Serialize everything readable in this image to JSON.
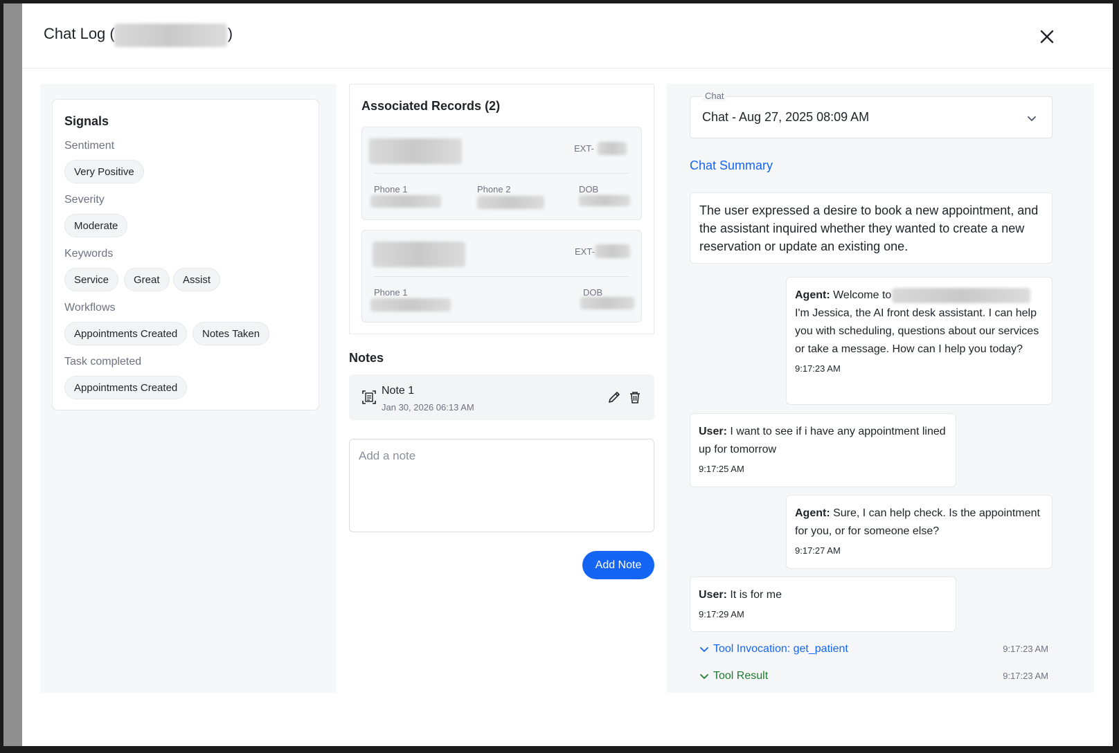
{
  "modal": {
    "title": "Chat Log (",
    "title_suffix": ")"
  },
  "signals": {
    "title": "Signals",
    "sentiment_label": "Sentiment",
    "sentiment": "Very Positive",
    "severity_label": "Severity",
    "severity": "Moderate",
    "keywords_label": "Keywords",
    "keywords": [
      "Service",
      "Great",
      "Assist"
    ],
    "workflows_label": "Workflows",
    "workflows": [
      "Appointments Created",
      "Notes Taken"
    ],
    "task_label": "Task completed",
    "tasks": [
      "Appointments Created"
    ]
  },
  "records": {
    "title": "Associated Records (2)",
    "items": [
      {
        "ext": "EXT-",
        "fields": [
          "Phone 1",
          "Phone 2",
          "DOB"
        ]
      },
      {
        "ext": "EXT-",
        "fields": [
          "Phone 1",
          "DOB"
        ]
      }
    ]
  },
  "notes": {
    "title": "Notes",
    "items": [
      {
        "title": "Note 1",
        "date": "Jan 30, 2026 06:13 AM"
      }
    ],
    "input_placeholder": "Add a note",
    "add_button": "Add Note"
  },
  "chat": {
    "select_label": "Chat",
    "selected": "Chat - Aug 27, 2025 08:09 AM",
    "summary_title": "Chat Summary",
    "summary": "The user expressed a desire to book a new appointment, and the assistant inquired whether they wanted to create a new reservation or update an existing one.",
    "messages": [
      {
        "speaker": "Agent:",
        "text_before": " Welcome to ",
        "text": "I'm Jessica, the AI front desk assistant. I can help you with scheduling, questions about our services or take a message. How can I help you today?",
        "time": "9:17:23 AM"
      },
      {
        "speaker": "User:",
        "text": " I want to see if i have any appointment lined up for tomorrow",
        "time": "9:17:25 AM"
      },
      {
        "speaker": "Agent:",
        "text": " Sure, I can help check. Is the appointment for you, or for someone else?",
        "time": "9:17:27 AM"
      },
      {
        "speaker": "User:",
        "text": " It is for me",
        "time": "9:17:29 AM"
      }
    ],
    "tools": [
      {
        "label": "Tool Invocation: get_patient",
        "time": "9:17:23 AM",
        "color": "#1565f5"
      },
      {
        "label": "Tool Result",
        "time": "9:17:23 AM",
        "color": "#1e7a2e"
      }
    ]
  },
  "colors": {
    "accent": "#1565f5",
    "tool_result": "#1e7a2e",
    "panel_bg": "#f6f7f8"
  }
}
